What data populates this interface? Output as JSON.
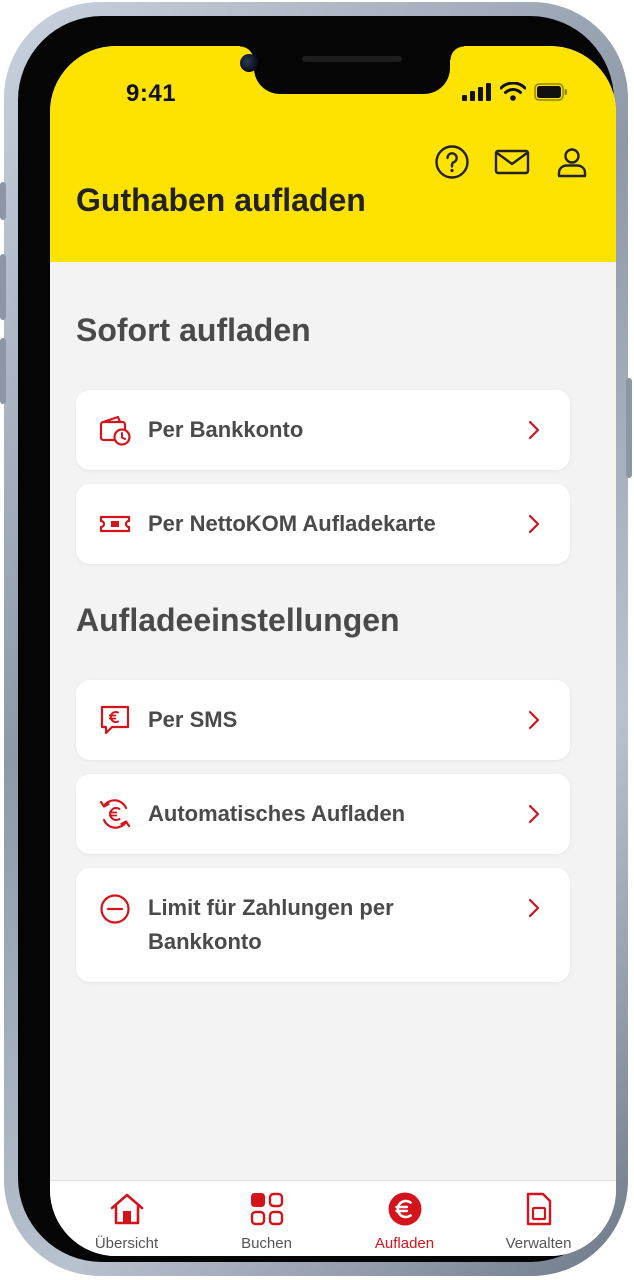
{
  "status_bar": {
    "time": "9:41"
  },
  "header": {
    "title": "Guthaben aufladen"
  },
  "sections": [
    {
      "title": "Sofort aufladen",
      "items": [
        {
          "label": "Per Bankkonto",
          "icon": "wallet-clock-icon"
        },
        {
          "label": "Per NettoKOM Aufladekarte",
          "icon": "ticket-icon"
        }
      ]
    },
    {
      "title": "Aufladeeinstellungen",
      "items": [
        {
          "label": "Per SMS",
          "icon": "sms-euro-icon"
        },
        {
          "label": "Automatisches Aufladen",
          "icon": "euro-refresh-icon"
        },
        {
          "label": "Limit für Zahlungen per Bankkonto",
          "icon": "minus-circle-icon"
        }
      ]
    }
  ],
  "tabs": [
    {
      "label": "Übersicht",
      "icon": "home-icon",
      "active": false
    },
    {
      "label": "Buchen",
      "icon": "grid-icon",
      "active": false
    },
    {
      "label": "Aufladen",
      "icon": "euro-circle-icon",
      "active": true
    },
    {
      "label": "Verwalten",
      "icon": "sim-card-icon",
      "active": false
    }
  ],
  "colors": {
    "header_bg": "#ffe300",
    "accent_red": "#d4141b",
    "page_bg": "#f3f3f3",
    "text": "#4a4a4a"
  }
}
